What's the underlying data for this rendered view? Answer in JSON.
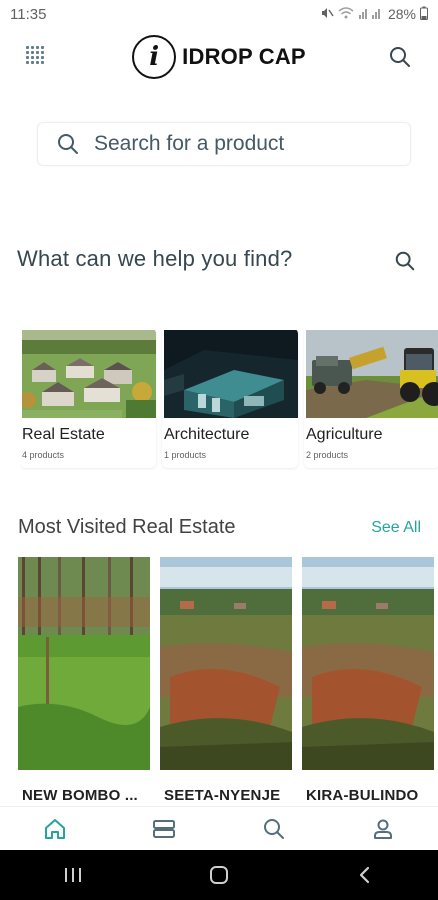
{
  "status_bar": {
    "time": "11:35",
    "battery": "28%"
  },
  "header": {
    "logo_letter": "i",
    "logo_text": "IDROP CAP"
  },
  "search": {
    "placeholder": "Search for a product"
  },
  "help_section": {
    "title": "What can we help you find?"
  },
  "categories": [
    {
      "name": "Real Estate",
      "count": "4 products"
    },
    {
      "name": "Architecture",
      "count": "1 products"
    },
    {
      "name": "Agriculture",
      "count": "2 products"
    }
  ],
  "most_visited": {
    "title": "Most Visited Real Estate",
    "see_all": "See All",
    "products": [
      {
        "name": "NEW BOMBO ..."
      },
      {
        "name": "SEETA-NYENJE"
      },
      {
        "name": "KIRA-BULINDO"
      }
    ]
  },
  "colors": {
    "accent": "#26a69a",
    "text_dark": "#212121",
    "icon_gray": "#546e7a"
  },
  "icons": {
    "menu": "grid-menu-icon",
    "search": "search-icon",
    "home": "home-icon",
    "listings": "listings-icon",
    "profile": "person-icon"
  }
}
